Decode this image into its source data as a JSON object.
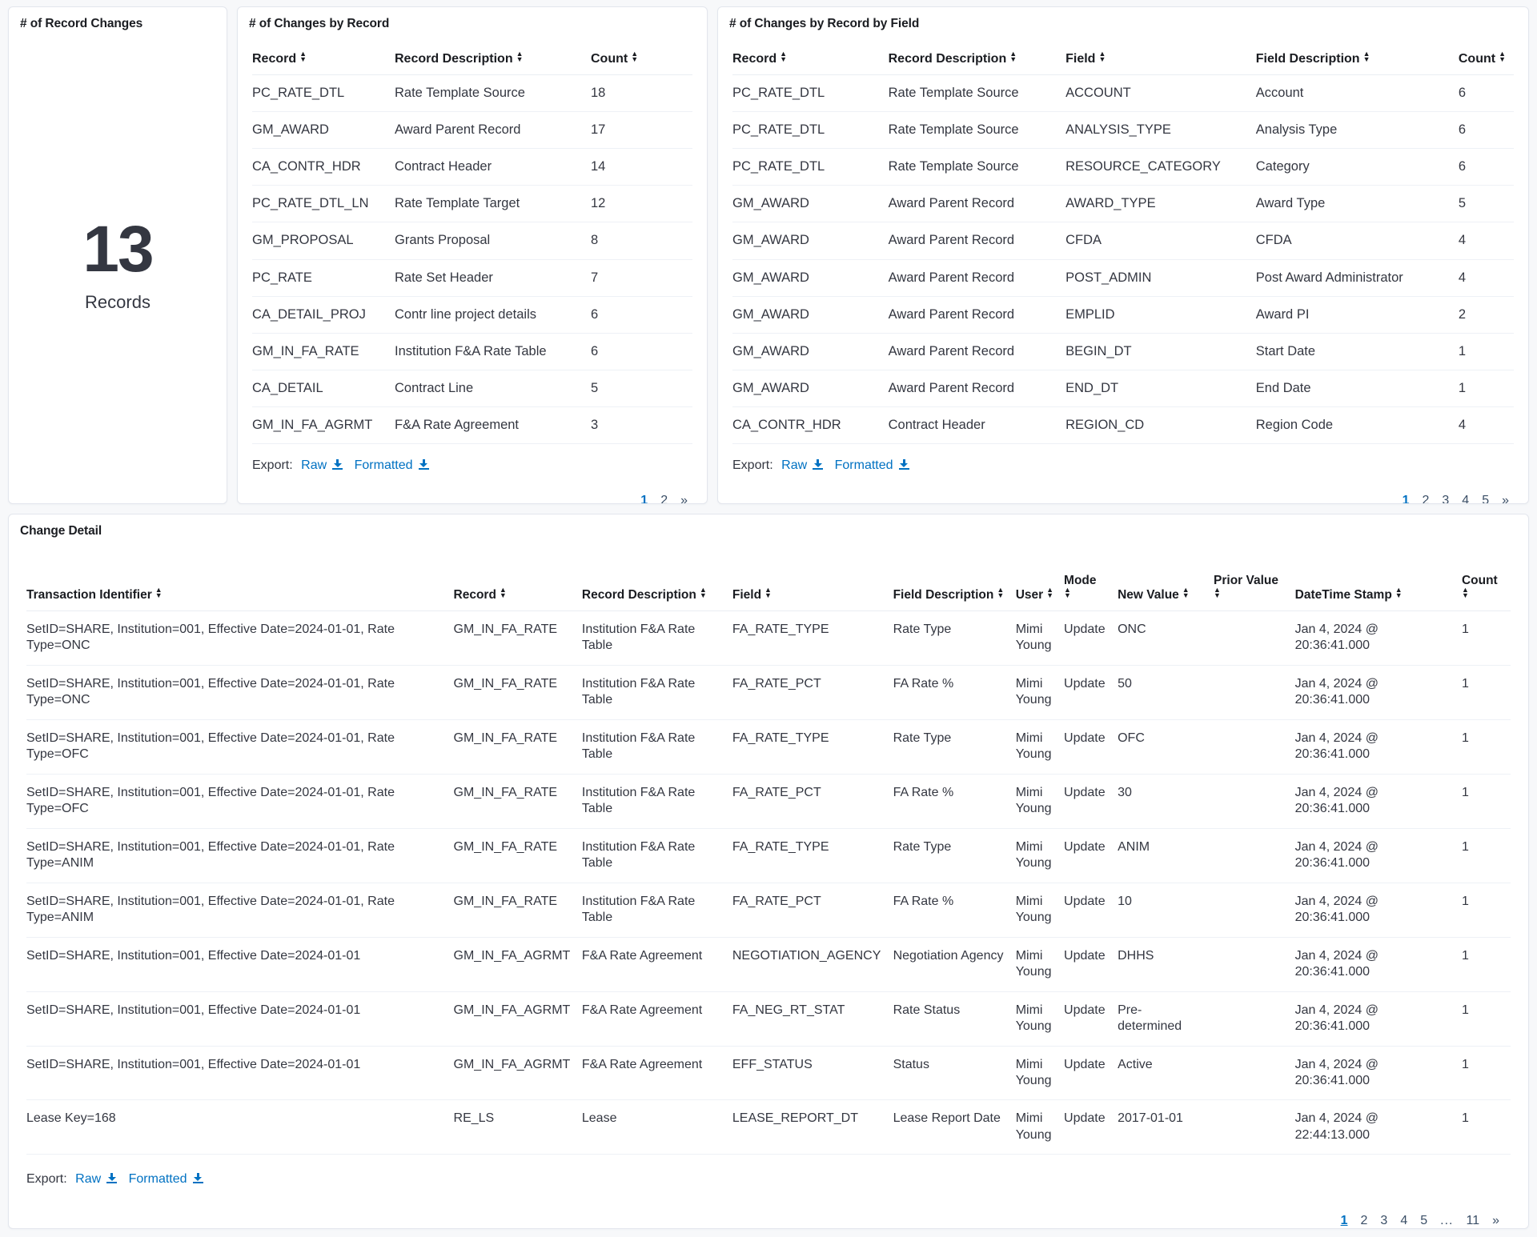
{
  "metric_panel": {
    "title": "# of Record Changes",
    "value": "13",
    "label": "Records"
  },
  "by_record_panel": {
    "title": "# of Changes by Record",
    "columns": [
      "Record",
      "Record Description",
      "Count"
    ],
    "rows": [
      [
        "PC_RATE_DTL",
        "Rate Template Source",
        "18"
      ],
      [
        "GM_AWARD",
        "Award Parent Record",
        "17"
      ],
      [
        "CA_CONTR_HDR",
        "Contract Header",
        "14"
      ],
      [
        "PC_RATE_DTL_LN",
        "Rate Template Target",
        "12"
      ],
      [
        "GM_PROPOSAL",
        "Grants Proposal",
        "8"
      ],
      [
        "PC_RATE",
        "Rate Set Header",
        "7"
      ],
      [
        "CA_DETAIL_PROJ",
        "Contr line project details",
        "6"
      ],
      [
        "GM_IN_FA_RATE",
        "Institution F&A Rate Table",
        "6"
      ],
      [
        "CA_DETAIL",
        "Contract Line",
        "5"
      ],
      [
        "GM_IN_FA_AGRMT",
        "F&A Rate Agreement",
        "3"
      ]
    ],
    "export": {
      "label": "Export:",
      "raw": "Raw",
      "formatted": "Formatted"
    },
    "pagination": {
      "pages": [
        "1",
        "2"
      ],
      "active": "1",
      "next": "»"
    }
  },
  "by_record_field_panel": {
    "title": "# of Changes by Record by Field",
    "columns": [
      "Record",
      "Record Description",
      "Field",
      "Field Description",
      "Count"
    ],
    "rows": [
      [
        "PC_RATE_DTL",
        "Rate Template Source",
        "ACCOUNT",
        "Account",
        "6"
      ],
      [
        "PC_RATE_DTL",
        "Rate Template Source",
        "ANALYSIS_TYPE",
        "Analysis Type",
        "6"
      ],
      [
        "PC_RATE_DTL",
        "Rate Template Source",
        "RESOURCE_CATEGORY",
        "Category",
        "6"
      ],
      [
        "GM_AWARD",
        "Award Parent Record",
        "AWARD_TYPE",
        "Award Type",
        "5"
      ],
      [
        "GM_AWARD",
        "Award Parent Record",
        "CFDA",
        "CFDA",
        "4"
      ],
      [
        "GM_AWARD",
        "Award Parent Record",
        "POST_ADMIN",
        "Post Award Administrator",
        "4"
      ],
      [
        "GM_AWARD",
        "Award Parent Record",
        "EMPLID",
        "Award PI",
        "2"
      ],
      [
        "GM_AWARD",
        "Award Parent Record",
        "BEGIN_DT",
        "Start Date",
        "1"
      ],
      [
        "GM_AWARD",
        "Award Parent Record",
        "END_DT",
        "End Date",
        "1"
      ],
      [
        "CA_CONTR_HDR",
        "Contract Header",
        "REGION_CD",
        "Region Code",
        "4"
      ]
    ],
    "export": {
      "label": "Export:",
      "raw": "Raw",
      "formatted": "Formatted"
    },
    "pagination": {
      "pages": [
        "1",
        "2",
        "3",
        "4",
        "5"
      ],
      "active": "1",
      "next": "»"
    }
  },
  "change_detail_panel": {
    "title": "Change Detail",
    "columns": [
      "Transaction Identifier",
      "Record",
      "Record Description",
      "Field",
      "Field Description",
      "User",
      "Mode",
      "New Value",
      "Prior Value",
      "DateTime Stamp",
      "Count"
    ],
    "rows": [
      [
        "SetID=SHARE, Institution=001, Effective Date=2024-01-01, Rate Type=ONC",
        "GM_IN_FA_RATE",
        "Institution F&A Rate Table",
        "FA_RATE_TYPE",
        "Rate Type",
        "Mimi Young",
        "Update",
        "ONC",
        "",
        "Jan 4, 2024 @ 20:36:41.000",
        "1"
      ],
      [
        "SetID=SHARE, Institution=001, Effective Date=2024-01-01, Rate Type=ONC",
        "GM_IN_FA_RATE",
        "Institution F&A Rate Table",
        "FA_RATE_PCT",
        "FA Rate %",
        "Mimi Young",
        "Update",
        "50",
        "",
        "Jan 4, 2024 @ 20:36:41.000",
        "1"
      ],
      [
        "SetID=SHARE, Institution=001, Effective Date=2024-01-01, Rate Type=OFC",
        "GM_IN_FA_RATE",
        "Institution F&A Rate Table",
        "FA_RATE_TYPE",
        "Rate Type",
        "Mimi Young",
        "Update",
        "OFC",
        "",
        "Jan 4, 2024 @ 20:36:41.000",
        "1"
      ],
      [
        "SetID=SHARE, Institution=001, Effective Date=2024-01-01, Rate Type=OFC",
        "GM_IN_FA_RATE",
        "Institution F&A Rate Table",
        "FA_RATE_PCT",
        "FA Rate %",
        "Mimi Young",
        "Update",
        "30",
        "",
        "Jan 4, 2024 @ 20:36:41.000",
        "1"
      ],
      [
        "SetID=SHARE, Institution=001, Effective Date=2024-01-01, Rate Type=ANIM",
        "GM_IN_FA_RATE",
        "Institution F&A Rate Table",
        "FA_RATE_TYPE",
        "Rate Type",
        "Mimi Young",
        "Update",
        "ANIM",
        "",
        "Jan 4, 2024 @ 20:36:41.000",
        "1"
      ],
      [
        "SetID=SHARE, Institution=001, Effective Date=2024-01-01, Rate Type=ANIM",
        "GM_IN_FA_RATE",
        "Institution F&A Rate Table",
        "FA_RATE_PCT",
        "FA Rate %",
        "Mimi Young",
        "Update",
        "10",
        "",
        "Jan 4, 2024 @ 20:36:41.000",
        "1"
      ],
      [
        "SetID=SHARE, Institution=001, Effective Date=2024-01-01",
        "GM_IN_FA_AGRMT",
        "F&A Rate Agreement",
        "NEGOTIATION_AGENCY",
        "Negotiation Agency",
        "Mimi Young",
        "Update",
        "DHHS",
        "",
        "Jan 4, 2024 @ 20:36:41.000",
        "1"
      ],
      [
        "SetID=SHARE, Institution=001, Effective Date=2024-01-01",
        "GM_IN_FA_AGRMT",
        "F&A Rate Agreement",
        "FA_NEG_RT_STAT",
        "Rate Status",
        "Mimi Young",
        "Update",
        "Pre-determined",
        "",
        "Jan 4, 2024 @ 20:36:41.000",
        "1"
      ],
      [
        "SetID=SHARE, Institution=001, Effective Date=2024-01-01",
        "GM_IN_FA_AGRMT",
        "F&A Rate Agreement",
        "EFF_STATUS",
        "Status",
        "Mimi Young",
        "Update",
        "Active",
        "",
        "Jan 4, 2024 @ 20:36:41.000",
        "1"
      ],
      [
        "Lease Key=168",
        "RE_LS",
        "Lease",
        "LEASE_REPORT_DT",
        "Lease Report Date",
        "Mimi Young",
        "Update",
        "2017-01-01",
        "",
        "Jan 4, 2024 @ 22:44:13.000",
        "1"
      ]
    ],
    "export": {
      "label": "Export:",
      "raw": "Raw",
      "formatted": "Formatted"
    },
    "pagination": {
      "pages": [
        "1",
        "2",
        "3",
        "4",
        "5"
      ],
      "ellipsis": "...",
      "last": "11",
      "active": "1",
      "next": "»"
    }
  },
  "colors": {
    "link": "#0071c2",
    "text": "#343741",
    "heading": "#1a1c21",
    "border": "#e3e6ed",
    "page_bg": "#f7f8fa"
  },
  "icons": {
    "sort": "sort-icon",
    "download": "download-icon"
  }
}
